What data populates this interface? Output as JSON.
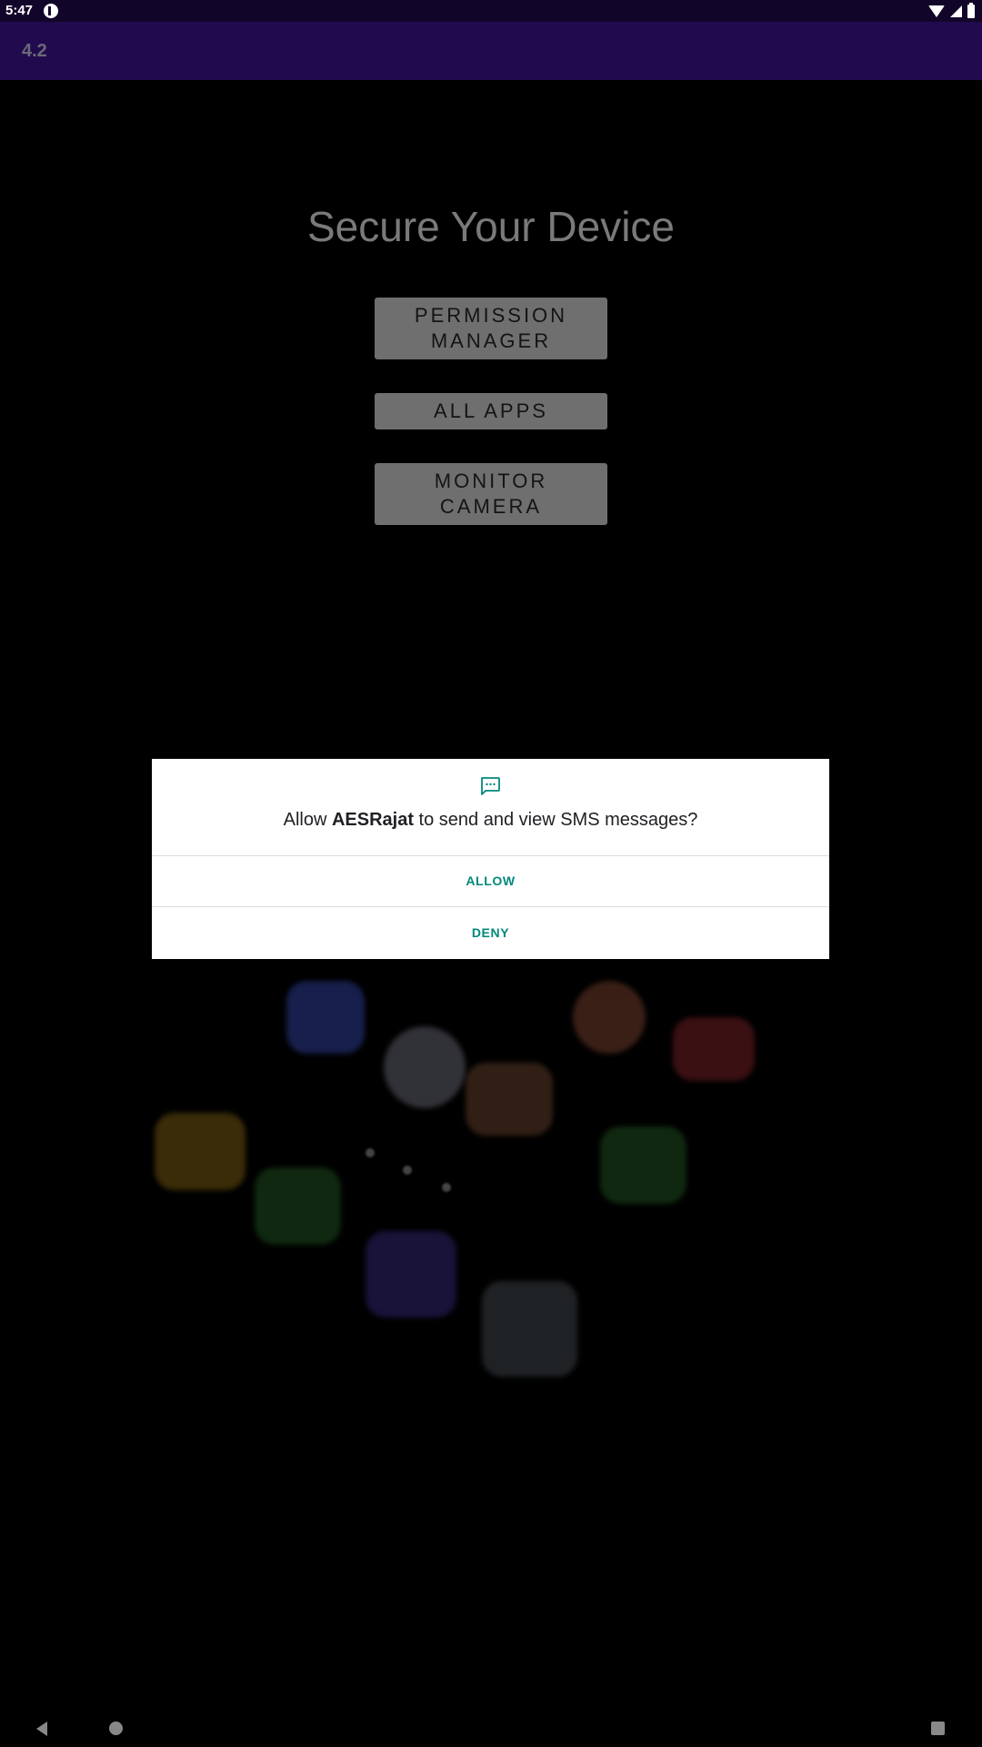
{
  "status_bar": {
    "time": "5:47",
    "icons": [
      "notification-icon",
      "wifi-icon",
      "signal-icon",
      "battery-icon"
    ]
  },
  "app_bar": {
    "title": "4.2"
  },
  "main": {
    "heading": "Secure Your Device",
    "buttons": [
      {
        "label_line1": "PERMISSION",
        "label_line2": "MANAGER"
      },
      {
        "label": "ALL APPS"
      },
      {
        "label_line1": "MONITOR",
        "label_line2": "CAMERA"
      }
    ]
  },
  "dialog": {
    "icon": "sms-icon",
    "message_prefix": "Allow ",
    "app_name": "AESRajat",
    "message_suffix": " to send and view SMS messages?",
    "allow_label": "ALLOW",
    "deny_label": "DENY",
    "accent_color": "#00897b"
  },
  "nav_bar": {
    "icons": [
      "back-icon",
      "home-icon",
      "recents-icon"
    ]
  },
  "colors": {
    "status_bar": "#12052a",
    "app_bar": "#220a4e",
    "button": "#6f6f6f"
  }
}
